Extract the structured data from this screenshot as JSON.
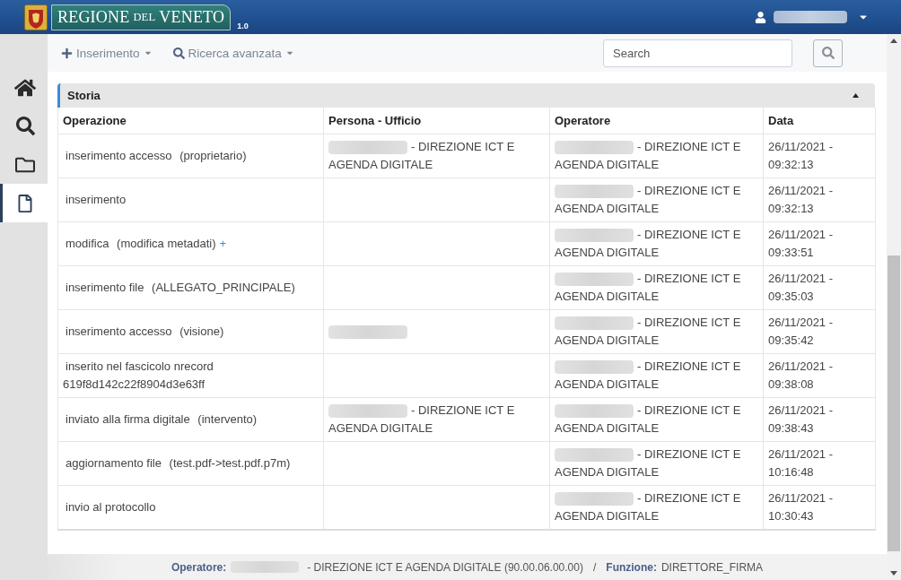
{
  "header": {
    "logo": {
      "parts": [
        {
          "text": "REGIONE",
          "kind": "large"
        },
        {
          "text": "DEL",
          "kind": "small"
        },
        {
          "text": "VENETO",
          "kind": "large"
        }
      ],
      "version": "1.0"
    },
    "user_menu": {
      "name_redacted": true
    }
  },
  "sidebar": {
    "items": [
      {
        "kind": "home",
        "selected": false
      },
      {
        "kind": "search",
        "selected": false
      },
      {
        "kind": "folder",
        "selected": false
      },
      {
        "kind": "file",
        "selected": true
      }
    ]
  },
  "toolbar": {
    "menus": [
      {
        "kind": "add",
        "label": "Inserimento"
      },
      {
        "kind": "search",
        "label": "Ricerca avanzata"
      }
    ],
    "search": {
      "placeholder": "Search"
    }
  },
  "panel": {
    "title": "Storia",
    "expanded": true,
    "columns": [
      "Operazione",
      "Persona - Ufficio",
      "Operatore",
      "Data"
    ],
    "rows": [
      {
        "operation": "inserimento accesso",
        "detail": "(proprietario)",
        "persona": {
          "name_redacted": true,
          "office": "- DIREZIONE ICT E AGENDA DIGITALE"
        },
        "operator": {
          "name_redacted": true,
          "office": "- DIREZIONE ICT E AGENDA DIGITALE"
        },
        "date": "26/11/2021 - 09:32:13"
      },
      {
        "operation": "inserimento",
        "operator": {
          "name_redacted": true,
          "office": "- DIREZIONE ICT E AGENDA DIGITALE"
        },
        "date": "26/11/2021 - 09:32:13"
      },
      {
        "operation": "modifica",
        "detail": "(modifica metadati)",
        "link": "+",
        "operator": {
          "name_redacted": true,
          "office": "- DIREZIONE ICT E AGENDA DIGITALE"
        },
        "date": "26/11/2021 - 09:33:51"
      },
      {
        "operation": "inserimento file",
        "detail": "(ALLEGATO_PRINCIPALE)",
        "operator": {
          "name_redacted": true,
          "office": "- DIREZIONE ICT E AGENDA DIGITALE"
        },
        "date": "26/11/2021 - 09:35:03"
      },
      {
        "operation": "inserimento accesso",
        "detail": "(visione)",
        "persona": {
          "name_redacted": true
        },
        "operator": {
          "name_redacted": true,
          "office": "- DIREZIONE ICT E AGENDA DIGITALE"
        },
        "date": "26/11/2021 - 09:35:42"
      },
      {
        "operation": "inserito nel fascicolo nrecord 619f8d142c22f8904d3e63ff",
        "operator": {
          "name_redacted": true,
          "office": "- DIREZIONE ICT E AGENDA DIGITALE"
        },
        "date": "26/11/2021 - 09:38:08"
      },
      {
        "operation": "inviato alla firma digitale",
        "detail": "(intervento)",
        "persona": {
          "name_redacted": true,
          "office": "- DIREZIONE ICT E AGENDA DIGITALE"
        },
        "operator": {
          "name_redacted": true,
          "office": "- DIREZIONE ICT E AGENDA DIGITALE"
        },
        "date": "26/11/2021 - 09:38:43"
      },
      {
        "operation": "aggiornamento file",
        "detail": "(test.pdf->test.pdf.p7m)",
        "operator": {
          "name_redacted": true,
          "office": "- DIREZIONE ICT E AGENDA DIGITALE"
        },
        "date": "26/11/2021 - 10:16:48"
      },
      {
        "operation": "invio al protocollo",
        "operator": {
          "name_redacted": true,
          "office": "- DIREZIONE ICT E AGENDA DIGITALE"
        },
        "date": "26/11/2021 - 10:30:43"
      }
    ]
  },
  "footer": {
    "items": [
      {
        "label": "Operatore:",
        "name_redacted": true,
        "value": "- DIREZIONE ICT E AGENDA DIGITALE (90.00.06.00.00)"
      },
      {
        "label": "Funzione:",
        "value": "DIRETTORE_FIRMA"
      }
    ],
    "separator": "/"
  }
}
